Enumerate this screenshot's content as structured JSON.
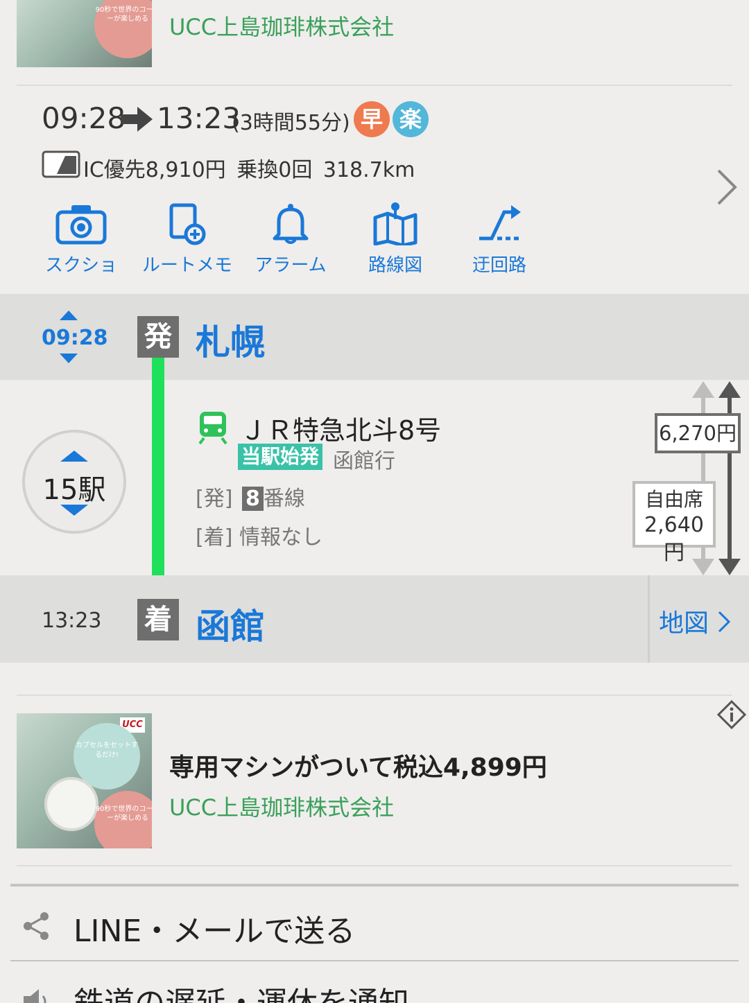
{
  "top_ad": {
    "company": "UCC上島珈琲株式会社",
    "thumb_text_b": "90秒で世界のコーヒーが楽しめる"
  },
  "route": {
    "depart_time": "09:28",
    "arrive_time": "13:23",
    "duration": "(3時間55分)",
    "badge_fast": "早",
    "badge_easy": "楽",
    "fare": "IC優先8,910円",
    "transfers": "乗換0回",
    "distance": "318.7km"
  },
  "tools": [
    {
      "label": "スクショ",
      "icon": "camera-icon"
    },
    {
      "label": "ルートメモ",
      "icon": "memo-add-icon"
    },
    {
      "label": "アラーム",
      "icon": "bell-icon"
    },
    {
      "label": "路線図",
      "icon": "route-map-icon"
    },
    {
      "label": "迂回路",
      "icon": "detour-icon"
    }
  ],
  "departure": {
    "time": "09:28",
    "mark": "発",
    "station": "札幌"
  },
  "segment": {
    "stops": "15駅",
    "train_name": "ＪＲ特急北斗8号",
    "origin_badge": "当駅始発",
    "destination": "函館行",
    "dep_label": "[発]",
    "track_number": "8",
    "track_suffix": "番線",
    "arr_label": "[着]",
    "arr_info": "情報なし",
    "fare_total": "6,270円",
    "seat_type": "自由席",
    "seat_fare": "2,640円"
  },
  "arrival": {
    "time": "13:23",
    "mark": "着",
    "station": "函館",
    "map_label": "地図"
  },
  "bottom_ad": {
    "title": "専用マシンがついて税込4,899円",
    "company": "UCC上島珈琲株式会社",
    "brand": "UCC",
    "thumb_text_a": "カプセルをセットするだけ!",
    "thumb_text_b": "90秒で世界のコーヒーが楽しめる"
  },
  "menu": {
    "share": "LINE・メールで送る",
    "notify": "鉄道の遅延・運休を通知"
  },
  "colors": {
    "accent_blue": "#1a78d8",
    "line_green": "#1ee05a",
    "badge_fast": "#f07a50",
    "badge_easy": "#53b7d9",
    "origin_badge": "#39c2a8"
  }
}
